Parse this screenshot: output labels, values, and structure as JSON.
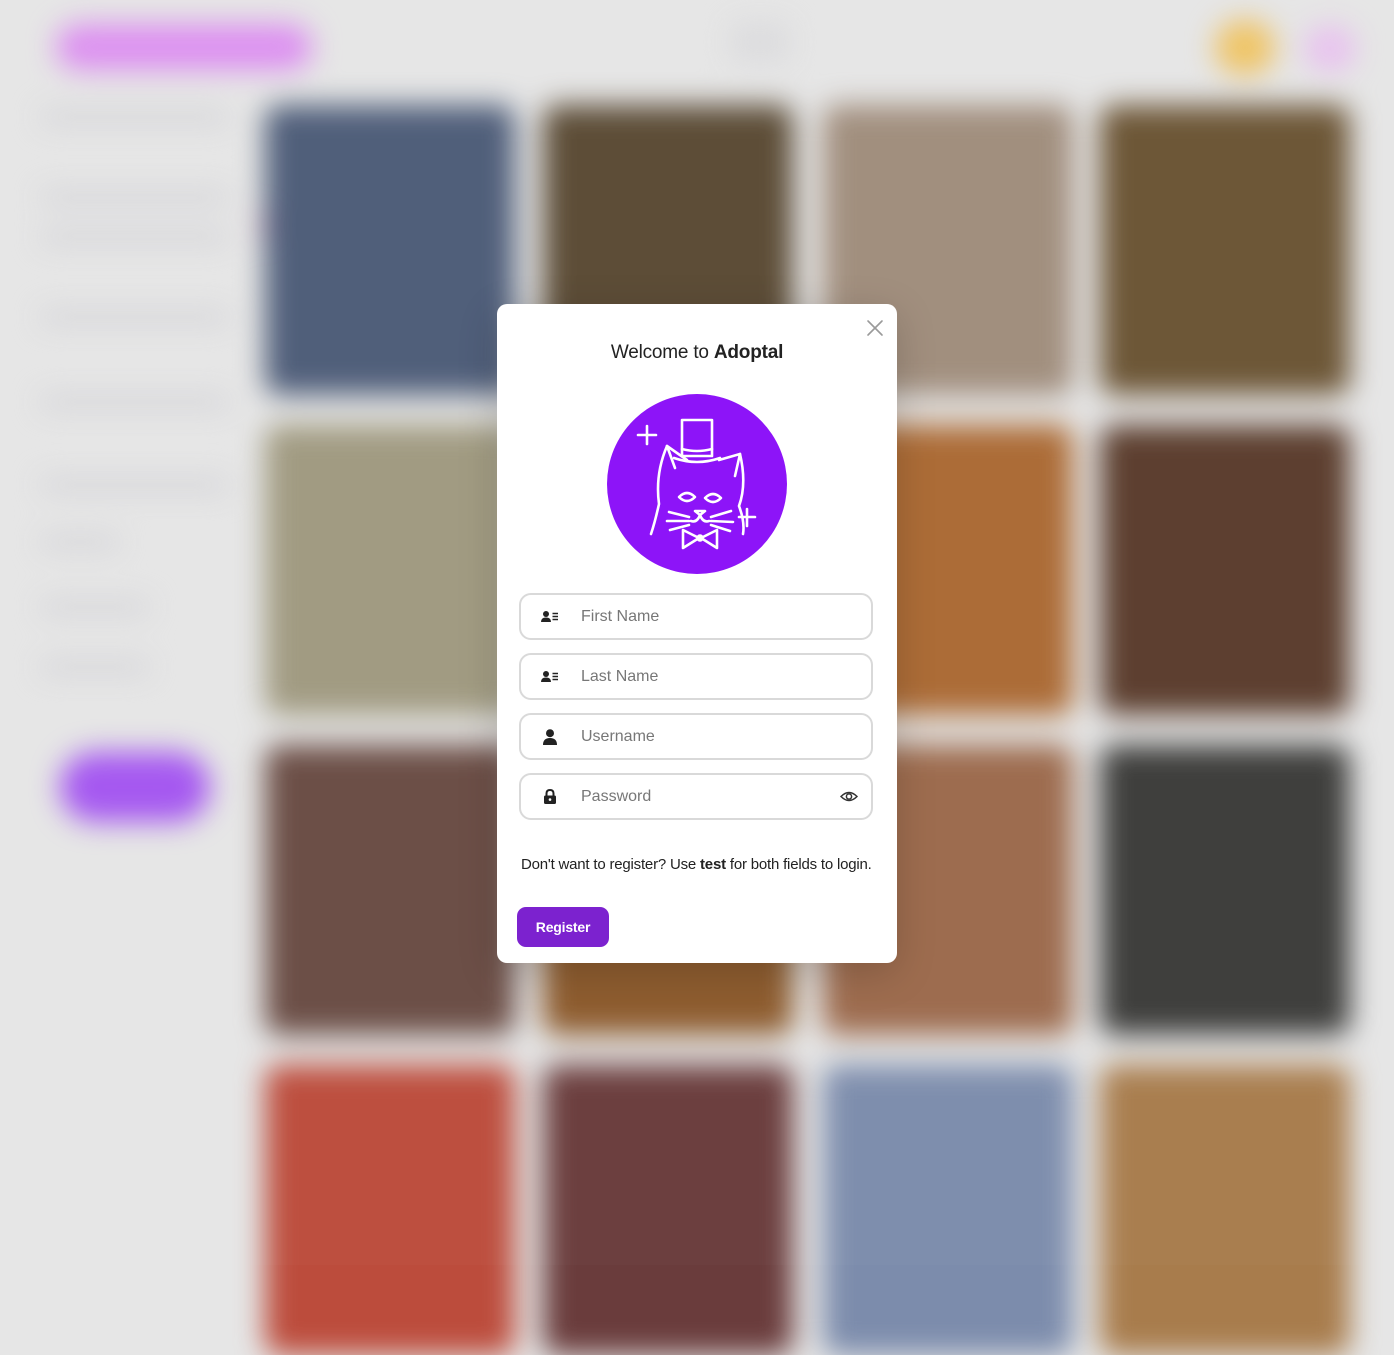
{
  "modal": {
    "title_prefix": "Welcome to ",
    "title_brand": "Adoptal",
    "avatar_icon": "cat-top-hat-icon",
    "brand_color": "#8d14f8",
    "fields": {
      "first_name": {
        "placeholder": "First Name",
        "value": "",
        "icon": "id-card-icon"
      },
      "last_name": {
        "placeholder": "Last Name",
        "value": "",
        "icon": "id-card-icon"
      },
      "username": {
        "placeholder": "Username",
        "value": "",
        "icon": "user-icon"
      },
      "password": {
        "placeholder": "Password",
        "value": "",
        "icon": "lock-icon",
        "toggle_icon": "eye-icon"
      }
    },
    "hint": {
      "before": "Don't want to register? Use ",
      "credential": "test",
      "after": " for both fields to login."
    },
    "register_label": "Register",
    "register_color": "#7c22cf",
    "close_icon": "close-icon"
  },
  "background": {
    "page_color": "#e6e6e6",
    "tile_colors": [
      "#4d5c78",
      "#5a4a34",
      "#a08d7c",
      "#6b5434",
      "#a09a80",
      "#7c6a4c",
      "#ab6a34",
      "#5a3c2c",
      "#6a4c44",
      "#8c5a2c",
      "#9c6a4c",
      "#3c3c3a",
      "#bc4c3c",
      "#6a3c3c",
      "#7c8cac",
      "#a87c4c"
    ]
  }
}
